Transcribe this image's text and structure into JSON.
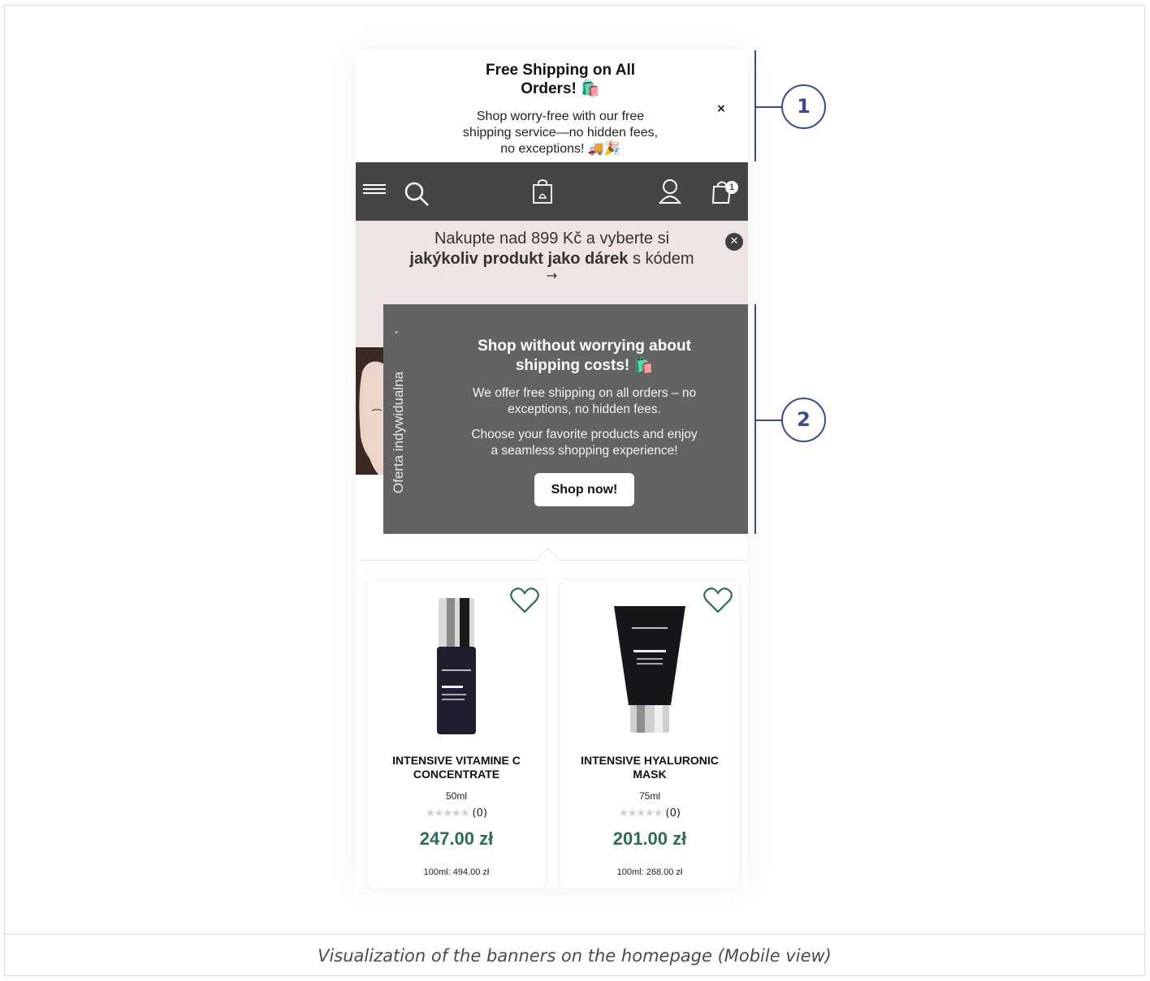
{
  "top_banner": {
    "title_line1": "Free Shipping on All",
    "title_line2": "Orders! 🛍️",
    "text_line1": "Shop worry-free with our free",
    "text_line2": "shipping service—no hidden fees,",
    "text_line3": "no exceptions! 🚚🎉",
    "close_label": "×"
  },
  "navbar": {
    "cart_count": "1",
    "icons": [
      "menu-icon",
      "search-icon",
      "shopping-bag-logo-icon",
      "user-icon",
      "cart-icon"
    ]
  },
  "promo": {
    "text_a": "Nakupte nad 899 Kč a vyberte si",
    "text_bold": "jakýkoliv produkt jako dárek",
    "text_b": " s kódem",
    "arrow": "→",
    "close_label": "✕"
  },
  "popup": {
    "side_tab_label": "Oferta indywidualna",
    "side_tab_chevron": "˅",
    "title_line1": "Shop without worrying about",
    "title_line2": "shipping costs! 🛍️",
    "para1_line1": "We offer free shipping on all orders – no",
    "para1_line2": "exceptions, no hidden fees.",
    "para2_line1": "Choose your favorite products and enjoy",
    "para2_line2": "a seamless shopping experience!",
    "button_label": "Shop now!"
  },
  "products": [
    {
      "name_line1": "INTENSIVE VITAMINE C",
      "name_line2": "CONCENTRATE",
      "size": "50ml",
      "stars": "★★★★★",
      "reviews": "(0)",
      "price": "247.00 zł",
      "unit_price": "100ml: 494.00 zł"
    },
    {
      "name_line1": "INTENSIVE HYALURONIC",
      "name_line2": "MASK",
      "size": "75ml",
      "stars": "★★★★★",
      "reviews": "(0)",
      "price": "201.00 zł",
      "unit_price": "100ml: 268.00 zł"
    }
  ],
  "callouts": {
    "one": "1",
    "two": "2"
  },
  "caption": "Visualization of the banners on the homepage (Mobile view)",
  "colors": {
    "navbar": "#454545",
    "promo_bg": "#efe4e4",
    "popup_bg": "#636363",
    "price_green": "#2f6b55",
    "callout_blue": "#3e4a8c"
  }
}
